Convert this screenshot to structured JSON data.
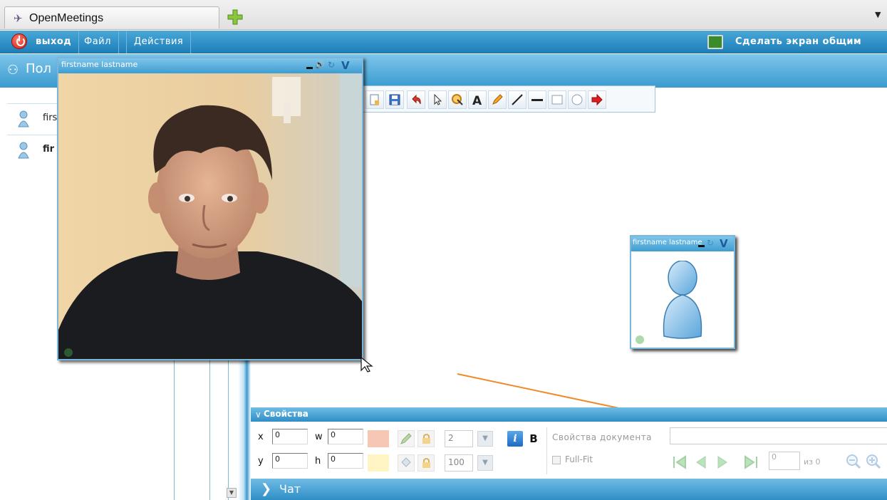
{
  "browser": {
    "tab_title": "OpenMeetings",
    "tab_icon": "openmeetings-logo-icon",
    "new_tab_icon": "plus-icon"
  },
  "menubar": {
    "exit_label": "выход",
    "file_label": "Файл",
    "actions_label": "Действия",
    "share_screen_label": "Сделать экран общим"
  },
  "users_panel": {
    "title": "Пол",
    "users": [
      {
        "name": "firs",
        "bold": false
      },
      {
        "name": "fir",
        "bold": true
      }
    ]
  },
  "video_main": {
    "title": "firstname lastname"
  },
  "video_small": {
    "title": "firstname lastname"
  },
  "whiteboard": {
    "tools": [
      "new-document-icon",
      "save-icon",
      "undo-icon",
      "pointer-icon",
      "zoom-icon",
      "text-tool-icon",
      "pencil-icon",
      "line-icon",
      "underline-icon",
      "rectangle-icon",
      "ellipse-icon",
      "arrow-icon"
    ]
  },
  "properties": {
    "title": "Свойства",
    "x_label": "x",
    "x_value": "0",
    "w_label": "w",
    "w_value": "0",
    "y_label": "y",
    "y_value": "0",
    "h_label": "h",
    "h_value": "0",
    "line_width": "2",
    "opacity": "100",
    "italic_label": "i",
    "bold_label": "B",
    "doc_properties_label": "Свойства документа",
    "fullfit_label": "Full-Fit",
    "page_value": "0",
    "page_of": "из 0",
    "colors": {
      "line": "#f5c7b4",
      "fill": "#fff4c4"
    }
  },
  "chat": {
    "title": "Чат"
  },
  "colors": {
    "accent": "#3a9bd0",
    "header_light": "#7ec5ea",
    "menubar": "#1d7fb9"
  }
}
